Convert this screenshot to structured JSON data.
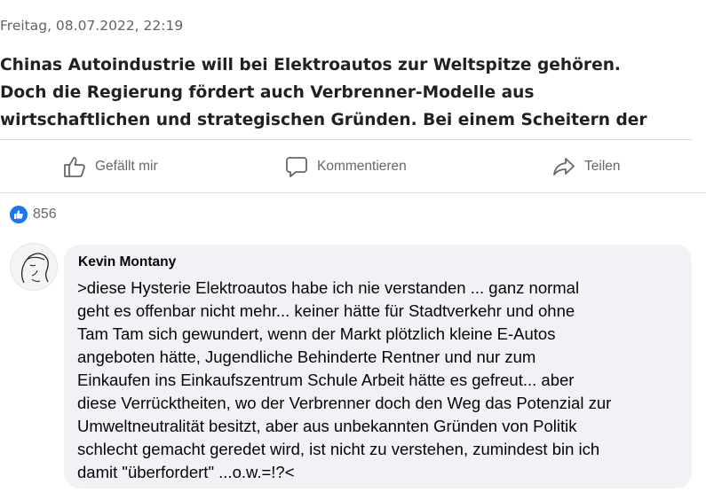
{
  "post": {
    "date": "Freitag, 08.07.2022, 22:19",
    "lines": [
      "Chinas Autoindustrie will bei Elektroautos zur Weltspitze gehören.",
      "Doch die Regierung fördert auch Verbrenner-Modelle aus",
      "wirtschaftlichen und strategischen Gründen. Bei einem Scheitern der"
    ]
  },
  "actions": {
    "like_label": "Gefällt mir",
    "comment_label": "Kommentieren",
    "share_label": "Teilen"
  },
  "reactions": {
    "count": "856"
  },
  "comment": {
    "author": "Kevin Montany",
    "lines": [
      ">diese Hysterie Elektroautos habe ich nie verstanden ... ganz normal",
      "geht es offenbar nicht mehr... keiner hätte für Stadtverkehr und ohne",
      "Tam Tam sich gewundert, wenn der Markt plötzlich kleine E-Autos",
      "angeboten hätte, Jugendliche  Behinderte Rentner und nur zum",
      "Einkaufen ins Einkaufszentrum Schule Arbeit hätte es gefreut... aber",
      "diese Verrücktheiten, wo der Verbrenner doch den Weg das Potenzial zur",
      "Umweltneutralität besitzt, aber aus unbekannten Gründen von Politik",
      "schlecht gemacht geredet wird, ist nicht zu verstehen, zumindest bin ich",
      "damit \"überfordert\" ...o.w.=!?<"
    ]
  },
  "colors": {
    "accent": "#1877f2",
    "bubble": "#f0f2f5",
    "muted_text": "#65676b"
  },
  "icons": [
    "thumbs-up-icon",
    "comment-icon",
    "share-icon",
    "like-reaction-icon"
  ]
}
